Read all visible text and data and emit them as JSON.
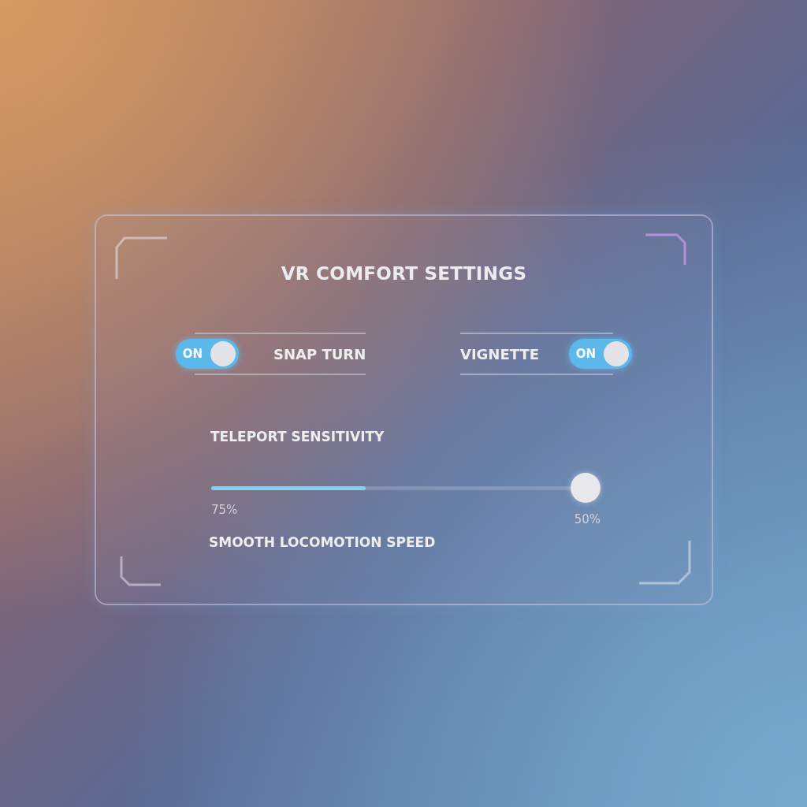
{
  "panel": {
    "title": "VR COMFORT SETTINGS"
  },
  "toggles": [
    {
      "label": "SNAP TURN",
      "state_text": "ON",
      "on": true
    },
    {
      "label": "VIGNETTE",
      "state_text": "ON",
      "on": true
    }
  ],
  "slider": {
    "label": "TELEPORT SENSITIVITY",
    "level": 0.43,
    "min_reading": "75%",
    "max_reading": "50%"
  },
  "footer_label": "SMOOTH LOCOMOTION SPEED"
}
